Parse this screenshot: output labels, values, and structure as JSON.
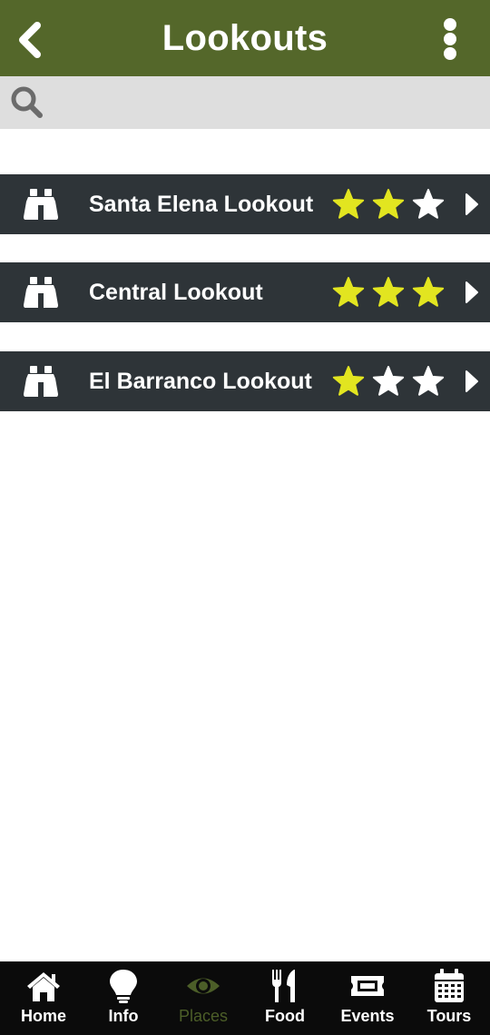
{
  "header": {
    "title": "Lookouts",
    "back_icon": "chevron-left-icon",
    "menu_icon": "more-vertical-icon"
  },
  "search": {
    "icon": "search-icon",
    "placeholder": "",
    "value": ""
  },
  "lookouts": [
    {
      "name": "Santa Elena Lookout",
      "rating": 2,
      "max_rating": 3,
      "icon": "binoculars-icon"
    },
    {
      "name": "Central Lookout",
      "rating": 3,
      "max_rating": 3,
      "icon": "binoculars-icon"
    },
    {
      "name": "El Barranco Lookout",
      "rating": 1,
      "max_rating": 3,
      "icon": "binoculars-icon"
    }
  ],
  "bottom_nav": {
    "items": [
      {
        "label": "Home",
        "icon": "home-icon",
        "active": false
      },
      {
        "label": "Info",
        "icon": "lightbulb-icon",
        "active": false
      },
      {
        "label": "Places",
        "icon": "eye-icon",
        "active": true
      },
      {
        "label": "Food",
        "icon": "utensils-icon",
        "active": false
      },
      {
        "label": "Events",
        "icon": "ticket-icon",
        "active": false
      },
      {
        "label": "Tours",
        "icon": "calendar-icon",
        "active": false
      }
    ]
  },
  "colors": {
    "header_bg": "#54672a",
    "list_bg": "#2e3438",
    "star_filled": "#e2e520",
    "star_empty": "#ffffff",
    "nav_bg": "#0b0b0b",
    "nav_active": "#4c5e28"
  }
}
